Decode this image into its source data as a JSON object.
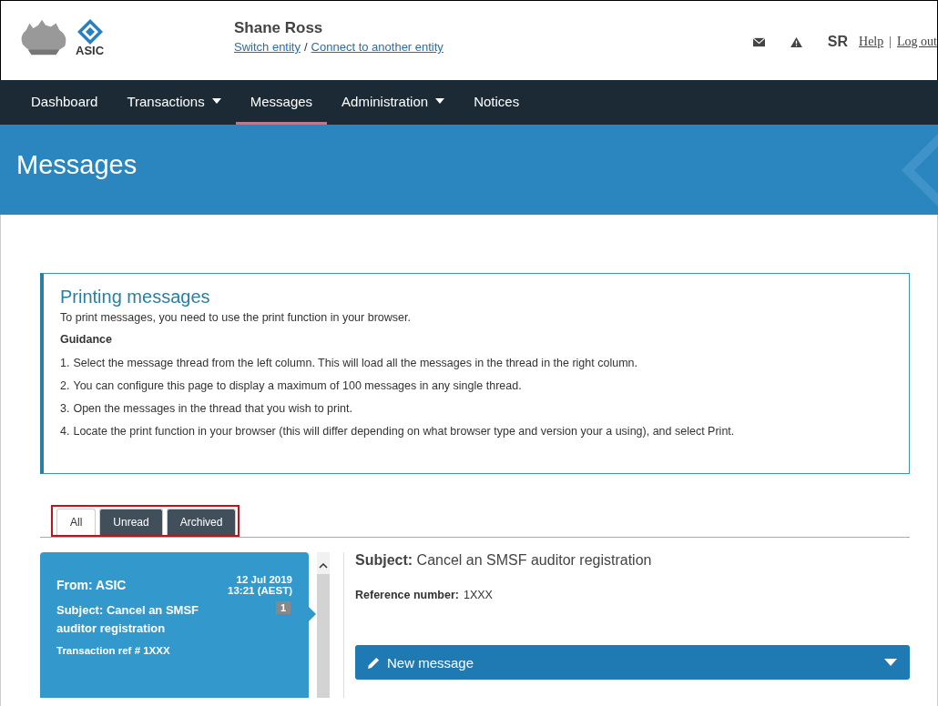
{
  "header": {
    "user_name": "Shane Ross",
    "links": [
      "Switch entity",
      "Connect to another entity"
    ],
    "link_separator": "/",
    "logo_text": "ASIC",
    "initials": "SR",
    "help": "Help",
    "separator": "|",
    "logout": "Log out"
  },
  "nav": [
    {
      "label": "Dashboard",
      "dropdown": false,
      "selected": false
    },
    {
      "label": "Transactions",
      "dropdown": true,
      "selected": false
    },
    {
      "label": "Messages",
      "dropdown": false,
      "selected": true
    },
    {
      "label": "Administration",
      "dropdown": true,
      "selected": false
    },
    {
      "label": "Notices",
      "dropdown": false,
      "selected": false
    }
  ],
  "page_title": "Messages",
  "info": {
    "title": "Printing messages",
    "intro": "To print messages, you need to use the print function in your browser.",
    "subheading": "Guidance",
    "steps": [
      {
        "number": "1.",
        "text": "Select the message thread from the left column. This will load all the messages in the thread in the right column."
      },
      {
        "number": "2.",
        "text": "You can configure this page to display a maximum of 100 messages in any single thread."
      },
      {
        "number": "3.",
        "text": "Open the messages in the thread that you wish to print."
      },
      {
        "number": "4.",
        "text": "Locate the print function in your browser (this will differ depending on what browser type and version your a using), and select Print."
      }
    ]
  },
  "tabs": [
    {
      "label": "All",
      "selected": true
    },
    {
      "label": "Unread",
      "selected": false
    },
    {
      "label": "Archived",
      "selected": false
    }
  ],
  "threads": [
    {
      "from": "From: ASIC",
      "date": "12 Jul 2019",
      "time": "13:21 (AEST)",
      "subject": "Subject: Cancel an SMSF auditor registration",
      "count": "1",
      "ref": "Transaction ref # 1XXX",
      "selected": true
    }
  ],
  "detail": {
    "subject": "**Subject:** Cancel an SMSF auditor registration",
    "ref_label": "Reference number:",
    "ref_value": "1XXX",
    "new_message": "New message"
  }
}
